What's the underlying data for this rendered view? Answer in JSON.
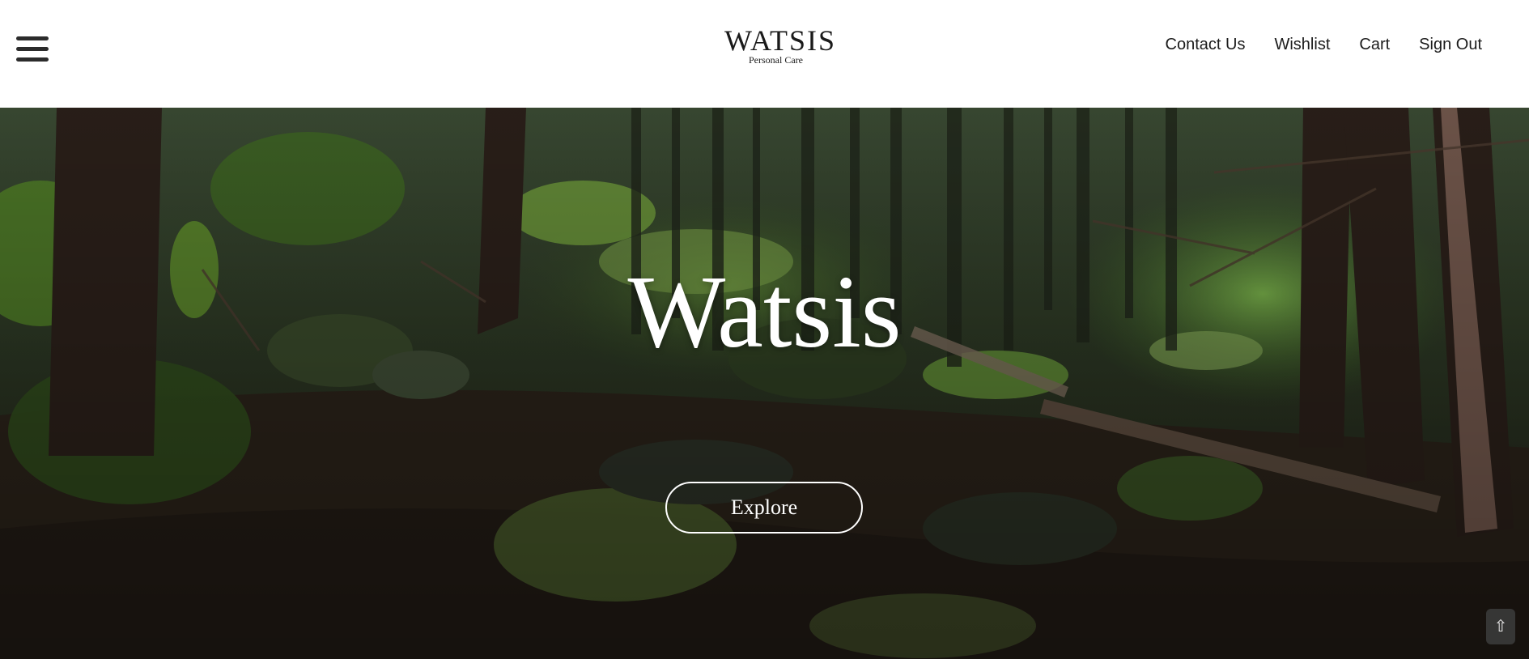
{
  "header": {
    "menu_icon": "hamburger-menu-icon",
    "logo": {
      "wordmark": "WATSIS",
      "tagline": "Personal Care"
    },
    "nav": [
      {
        "label": "Contact Us"
      },
      {
        "label": "Wishlist"
      },
      {
        "label": "Cart"
      },
      {
        "label": "Sign Out"
      }
    ]
  },
  "hero": {
    "title": "Watsis",
    "cta_label": "Explore",
    "background": "forest-image"
  },
  "scroll_top": {
    "icon": "up-arrow-icon",
    "glyph": "⇧"
  },
  "colors": {
    "header_bg": "#ffffff",
    "text_dark": "#1b1b1b",
    "hero_text": "#ffffff"
  }
}
